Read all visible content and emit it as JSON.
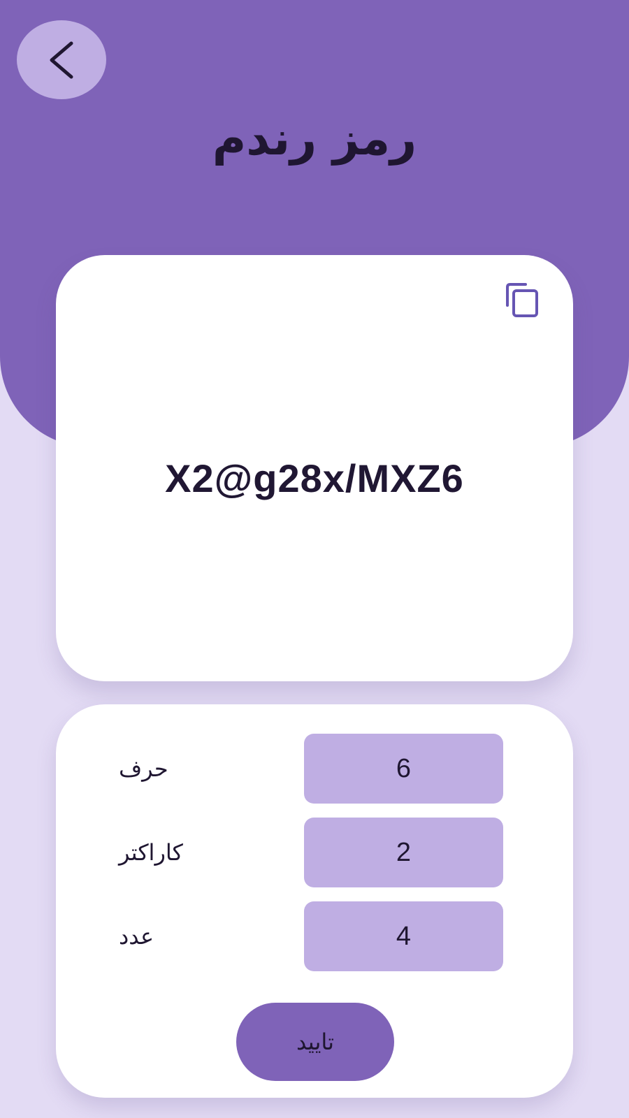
{
  "header": {
    "title": "رمز رندم",
    "back_icon": "chevron-left-icon"
  },
  "password_card": {
    "password": "X2@g28x/MXZ6",
    "copy_icon": "copy-icon"
  },
  "settings": {
    "rows": [
      {
        "label": "حرف",
        "value": "6"
      },
      {
        "label": "کاراکتر",
        "value": "2"
      },
      {
        "label": "عدد",
        "value": "4"
      }
    ],
    "confirm_label": "تایید"
  },
  "colors": {
    "primary": "#7f63b8",
    "primary_light": "#bfaee3",
    "background": "#e3dbf4",
    "card": "#ffffff",
    "text": "#1f1631"
  }
}
